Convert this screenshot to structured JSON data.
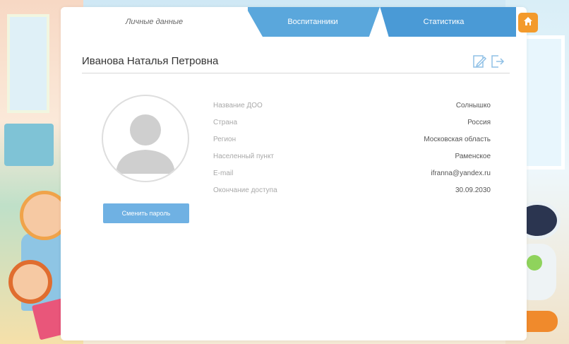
{
  "tabs": [
    {
      "label": "Личные данные"
    },
    {
      "label": "Воспитанники"
    },
    {
      "label": "Статистика"
    }
  ],
  "profile": {
    "full_name": "Иванова Наталья Петровна",
    "change_password_label": "Сменить пароль"
  },
  "info": [
    {
      "label": "Название ДОО",
      "value": "Солнышко"
    },
    {
      "label": "Страна",
      "value": "Россия"
    },
    {
      "label": "Регион",
      "value": "Московская область"
    },
    {
      "label": "Населенный пункт",
      "value": "Раменское"
    },
    {
      "label": "E-mail",
      "value": "ifranna@yandex.ru"
    },
    {
      "label": "Окончание доступа",
      "value": "30.09.2030"
    }
  ],
  "icons": {
    "edit": "edit-icon",
    "logout": "logout-icon",
    "home": "home-icon",
    "avatar": "user-placeholder-icon"
  },
  "colors": {
    "accent": "#5aa7dc",
    "button": "#6fb1e3",
    "home": "#f39a2c"
  }
}
